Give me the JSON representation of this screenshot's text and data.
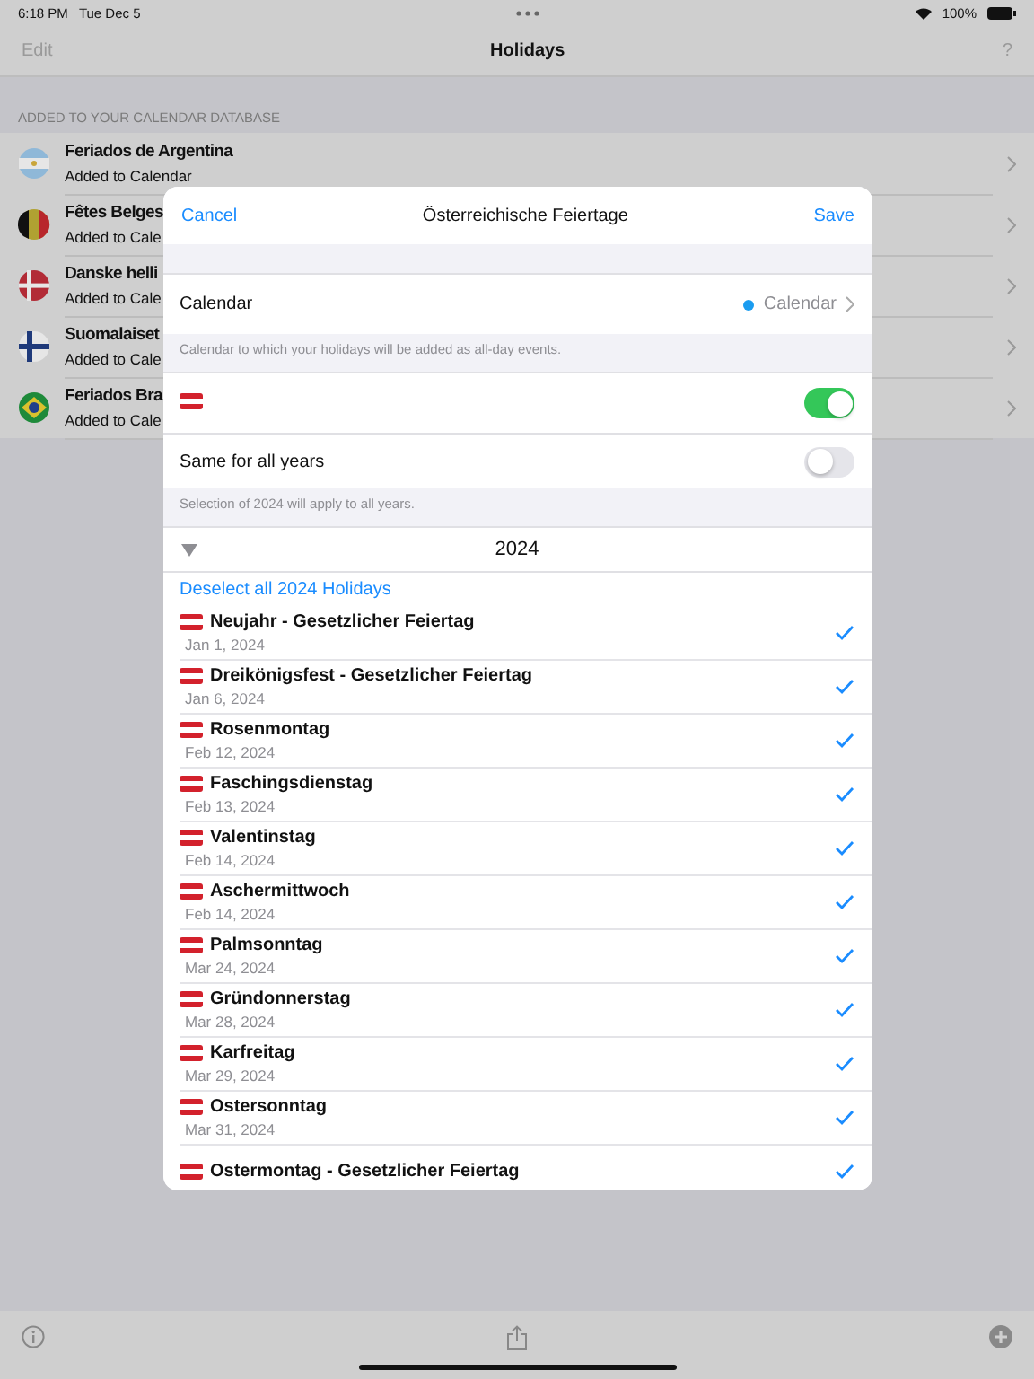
{
  "status_bar": {
    "time": "6:18 PM",
    "date": "Tue Dec 5",
    "battery": "100%"
  },
  "nav": {
    "left": "Edit",
    "title": "Holidays",
    "right": "?"
  },
  "section_header": "ADDED TO YOUR CALENDAR DATABASE",
  "calendars": [
    {
      "title": "Feriados de Argentina",
      "subtitle": "Added to Calendar"
    },
    {
      "title": "Fêtes Belges",
      "subtitle": "Added to Cale"
    },
    {
      "title": "Danske helli",
      "subtitle": "Added to Cale"
    },
    {
      "title": "Suomalaiset",
      "subtitle": "Added to Cale"
    },
    {
      "title": "Feriados Bra",
      "subtitle": "Added to Cale"
    }
  ],
  "sheet": {
    "cancel": "Cancel",
    "title": "Österreichische Feiertage",
    "save": "Save",
    "calendar_label": "Calendar",
    "calendar_value": "Calendar",
    "calendar_note": "Calendar to which your holidays will be added as all-day events.",
    "enabled": {
      "on": true
    },
    "same_years": {
      "label": "Same for all years",
      "on": false
    },
    "same_note": "Selection of 2024 will apply to all years.",
    "year": "2024",
    "expanded": true,
    "deselect": "Deselect all 2024 Holidays",
    "holidays": [
      {
        "name": "Neujahr - Gesetzlicher Feiertag",
        "date": "Jan 1, 2024",
        "checked": true
      },
      {
        "name": "Dreikönigsfest - Gesetzlicher Feiertag",
        "date": "Jan 6, 2024",
        "checked": true
      },
      {
        "name": "Rosenmontag",
        "date": "Feb 12, 2024",
        "checked": true
      },
      {
        "name": "Faschingsdienstag",
        "date": "Feb 13, 2024",
        "checked": true
      },
      {
        "name": "Valentinstag",
        "date": "Feb 14, 2024",
        "checked": true
      },
      {
        "name": "Aschermittwoch",
        "date": "Feb 14, 2024",
        "checked": true
      },
      {
        "name": "Palmsonntag",
        "date": "Mar 24, 2024",
        "checked": true
      },
      {
        "name": "Gründonnerstag",
        "date": "Mar 28, 2024",
        "checked": true
      },
      {
        "name": "Karfreitag",
        "date": "Mar 29, 2024",
        "checked": true
      },
      {
        "name": "Ostersonntag",
        "date": "Mar 31, 2024",
        "checked": true
      },
      {
        "name": "Ostermontag - Gesetzlicher Feiertag",
        "checked": true
      }
    ]
  }
}
